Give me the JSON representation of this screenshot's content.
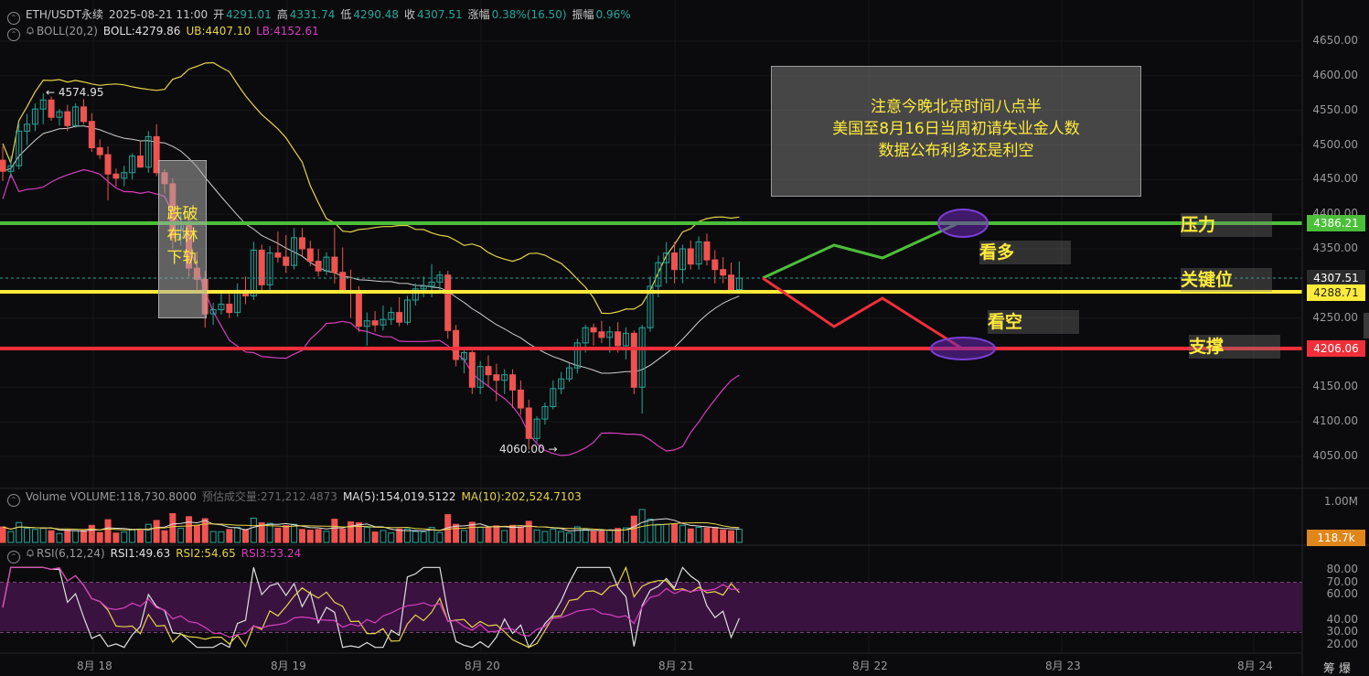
{
  "header": {
    "symbol": "ETH/USDT永续",
    "datetime": "2025-08-21 11:00",
    "open_label": "开",
    "open": "4291.01",
    "high_label": "高",
    "high": "4331.74",
    "low_label": "低",
    "low": "4290.48",
    "close_label": "收",
    "close": "4307.51",
    "change_label": "涨幅",
    "change": "0.38%(16.50)",
    "amp_label": "振幅",
    "amp": "0.96%"
  },
  "boll": {
    "name": "BOLL(20,2)",
    "mid": "BOLL:4279.86",
    "ub": "UB:4407.10",
    "lb": "LB:4152.61"
  },
  "volume_hdr": {
    "name": "Volume",
    "volume": "VOLUME:118,730.8000",
    "est": "预估成交量:271,212.4873",
    "ma5": "MA(5):154,019.5122",
    "ma10": "MA(10):202,524.7103"
  },
  "rsi_hdr": {
    "name": "RSI(6,12,24)",
    "rsi1": "RSI1:49.63",
    "rsi2": "RSI2:54.65",
    "rsi3": "RSI3:53.24"
  },
  "note": {
    "line1": "注意今晚北京时间八点半",
    "line2": "美国至8月16日当周初请失业金人数",
    "line3": "数据公布利多还是利空"
  },
  "break_label": {
    "line1": "跌破",
    "line2": "布林",
    "line3": "下轨"
  },
  "levels": {
    "resistance_label": "压力",
    "key_label": "关键位",
    "support_label": "支撑",
    "bull_label": "看多",
    "bear_label": "看空",
    "resistance_tag": "4386.21",
    "current_tag": "4307.51",
    "key_tag": "4288.71",
    "support_tag": "4206.06",
    "volume_tag": "118.7k"
  },
  "annotations": {
    "high_mark": "← 4574.95",
    "low_mark": "4060.00 →"
  },
  "price_axis": [
    "4650.00",
    "4600.00",
    "4550.00",
    "4500.00",
    "4450.00",
    "4400.00",
    "4350.00",
    "4250.00",
    "4150.00",
    "4100.00",
    "4050.00"
  ],
  "volume_axis": [
    "1.00M"
  ],
  "rsi_axis": [
    "80.00",
    "70.00",
    "60.00",
    "40.00",
    "30.00",
    "20.00"
  ],
  "date_axis": [
    "8月 18",
    "8月 19",
    "8月 20",
    "8月 21",
    "8月 22",
    "8月 23",
    "8月 24"
  ],
  "corner_label": "筹 爆",
  "colors": {
    "up": "#26a69a",
    "down": "#ef5350",
    "ub": "#e6d34a",
    "lb": "#d63fbf",
    "mid": "#cfcfcf",
    "green_line": "#4cbf3a",
    "yellow_line": "#ffeb3b",
    "red_line": "#f02f3a",
    "rsi_bg": "#3a1240"
  },
  "chart_data": {
    "type": "candlestick",
    "interval": "1h",
    "candles_ohlc": [
      [
        4478,
        4498,
        4448,
        4462
      ],
      [
        4462,
        4484,
        4452,
        4470
      ],
      [
        4470,
        4532,
        4465,
        4520
      ],
      [
        4520,
        4545,
        4500,
        4530
      ],
      [
        4530,
        4560,
        4520,
        4552
      ],
      [
        4552,
        4574.95,
        4530,
        4565
      ],
      [
        4565,
        4570,
        4535,
        4540
      ],
      [
        4540,
        4552,
        4528,
        4548
      ],
      [
        4548,
        4558,
        4520,
        4528
      ],
      [
        4528,
        4560,
        4525,
        4555
      ],
      [
        4555,
        4566,
        4530,
        4534
      ],
      [
        4534,
        4546,
        4490,
        4496
      ],
      [
        4496,
        4508,
        4480,
        4486
      ],
      [
        4486,
        4498,
        4420,
        4458
      ],
      [
        4458,
        4466,
        4440,
        4452
      ],
      [
        4452,
        4470,
        4440,
        4460
      ],
      [
        4460,
        4488,
        4450,
        4484
      ],
      [
        4484,
        4506,
        4470,
        4468
      ],
      [
        4468,
        4520,
        4460,
        4512
      ],
      [
        4512,
        4530,
        4455,
        4460
      ],
      [
        4460,
        4465,
        4430,
        4444
      ],
      [
        4444,
        4452,
        4350,
        4366
      ],
      [
        4366,
        4400,
        4355,
        4388
      ],
      [
        4388,
        4400,
        4310,
        4322
      ],
      [
        4322,
        4346,
        4290,
        4306
      ],
      [
        4306,
        4318,
        4236,
        4256
      ],
      [
        4256,
        4272,
        4240,
        4262
      ],
      [
        4262,
        4286,
        4255,
        4270
      ],
      [
        4270,
        4290,
        4250,
        4258
      ],
      [
        4258,
        4300,
        4252,
        4290
      ],
      [
        4290,
        4310,
        4270,
        4282
      ],
      [
        4282,
        4360,
        4276,
        4348
      ],
      [
        4348,
        4356,
        4290,
        4298
      ],
      [
        4298,
        4354,
        4290,
        4344
      ],
      [
        4344,
        4375,
        4330,
        4338
      ],
      [
        4338,
        4370,
        4315,
        4326
      ],
      [
        4326,
        4380,
        4320,
        4366
      ],
      [
        4366,
        4380,
        4340,
        4350
      ],
      [
        4350,
        4362,
        4325,
        4332
      ],
      [
        4332,
        4350,
        4310,
        4318
      ],
      [
        4318,
        4345,
        4312,
        4338
      ],
      [
        4338,
        4380,
        4300,
        4316
      ],
      [
        4316,
        4352,
        4310,
        4288
      ],
      [
        4288,
        4320,
        4250,
        4286
      ],
      [
        4286,
        4296,
        4230,
        4238
      ],
      [
        4238,
        4258,
        4210,
        4246
      ],
      [
        4246,
        4260,
        4230,
        4240
      ],
      [
        4240,
        4268,
        4232,
        4248
      ],
      [
        4248,
        4266,
        4240,
        4258
      ],
      [
        4258,
        4280,
        4238,
        4244
      ],
      [
        4244,
        4282,
        4240,
        4276
      ],
      [
        4276,
        4300,
        4268,
        4292
      ],
      [
        4292,
        4310,
        4280,
        4296
      ],
      [
        4296,
        4328,
        4280,
        4302
      ],
      [
        4302,
        4318,
        4290,
        4312
      ],
      [
        4312,
        4318,
        4220,
        4232
      ],
      [
        4232,
        4240,
        4180,
        4190
      ],
      [
        4190,
        4206,
        4170,
        4200
      ],
      [
        4200,
        4208,
        4140,
        4150
      ],
      [
        4150,
        4188,
        4140,
        4180
      ],
      [
        4180,
        4196,
        4150,
        4168
      ],
      [
        4168,
        4184,
        4130,
        4160
      ],
      [
        4160,
        4176,
        4140,
        4168
      ],
      [
        4168,
        4176,
        4120,
        4146
      ],
      [
        4146,
        4160,
        4110,
        4120
      ],
      [
        4120,
        4132,
        4060,
        4076
      ],
      [
        4076,
        4108,
        4070,
        4104
      ],
      [
        4104,
        4128,
        4096,
        4122
      ],
      [
        4122,
        4160,
        4118,
        4148
      ],
      [
        4148,
        4172,
        4140,
        4162
      ],
      [
        4162,
        4184,
        4158,
        4178
      ],
      [
        4178,
        4220,
        4170,
        4214
      ],
      [
        4214,
        4240,
        4200,
        4236
      ],
      [
        4236,
        4242,
        4210,
        4230
      ],
      [
        4230,
        4246,
        4214,
        4222
      ],
      [
        4222,
        4238,
        4200,
        4230
      ],
      [
        4230,
        4244,
        4200,
        4210
      ],
      [
        4210,
        4236,
        4190,
        4228
      ],
      [
        4228,
        4232,
        4140,
        4150
      ],
      [
        4150,
        4240,
        4112,
        4236
      ],
      [
        4236,
        4310,
        4230,
        4296
      ],
      [
        4296,
        4340,
        4280,
        4330
      ],
      [
        4330,
        4360,
        4300,
        4344
      ],
      [
        4344,
        4360,
        4300,
        4320
      ],
      [
        4320,
        4356,
        4300,
        4350
      ],
      [
        4350,
        4362,
        4320,
        4328
      ],
      [
        4328,
        4368,
        4320,
        4360
      ],
      [
        4360,
        4372,
        4326,
        4334
      ],
      [
        4334,
        4348,
        4300,
        4320
      ],
      [
        4320,
        4338,
        4300,
        4312
      ],
      [
        4312,
        4330,
        4295,
        4291.01
      ],
      [
        4291.01,
        4331.74,
        4290.48,
        4307.51
      ]
    ],
    "volume_axis_max": 1000000,
    "rsi_range": [
      20,
      80
    ],
    "rsi_bands": [
      30,
      70
    ],
    "projections": [
      {
        "name": "看多",
        "path": [
          [
            0,
            4307.51
          ],
          [
            10,
            4360
          ],
          [
            17,
            4340
          ],
          [
            27,
            4386.21
          ]
        ]
      },
      {
        "name": "看空",
        "path": [
          [
            0,
            4307.51
          ],
          [
            10,
            4240
          ],
          [
            17,
            4280
          ],
          [
            27,
            4206.06
          ]
        ]
      }
    ]
  }
}
